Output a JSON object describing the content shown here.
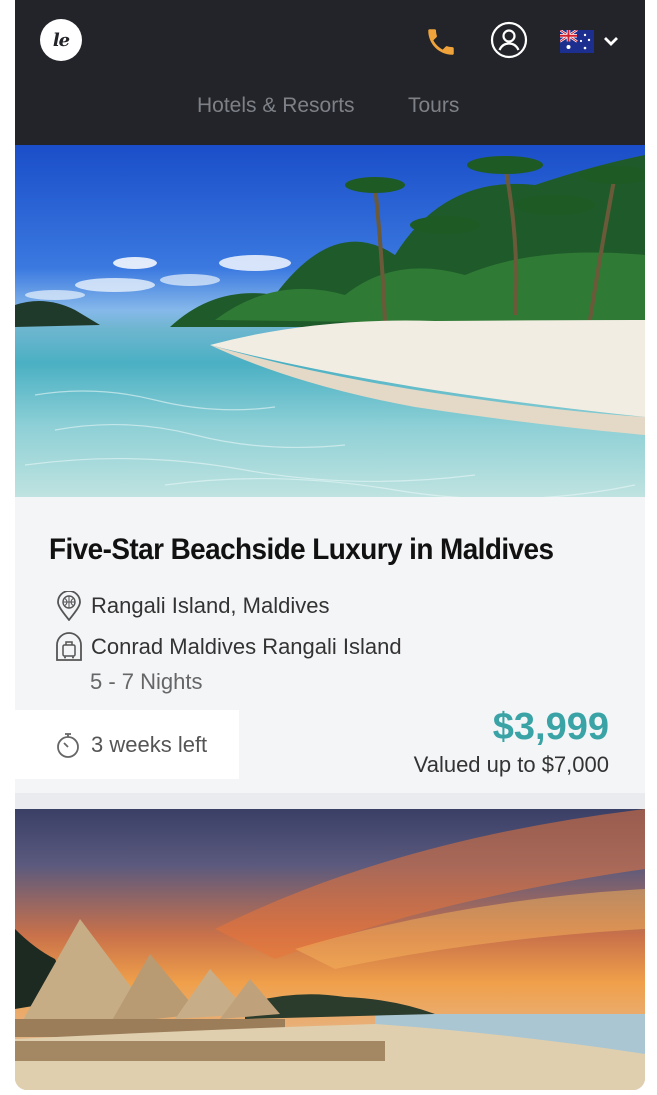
{
  "header": {
    "logo_text": "le",
    "icons": [
      "logo-icon",
      "phone-icon",
      "account-icon",
      "australia-flag-icon",
      "chevron-down-icon"
    ],
    "nav": [
      {
        "label": "Hotels & Resorts"
      },
      {
        "label": "Tours"
      }
    ]
  },
  "listing": {
    "title": "Five-Star Beachside Luxury in Maldives",
    "location": "Rangali Island, Maldives",
    "hotel": "Conrad Maldives Rangali Island",
    "nights": "5 - 7 Nights",
    "time_left": "3 weeks left",
    "price": "$3,999",
    "valued": "Valued up to $7,000"
  },
  "colors": {
    "header_bg": "#232429",
    "accent_phone": "#f0a23b",
    "price": "#3aa3a6"
  }
}
